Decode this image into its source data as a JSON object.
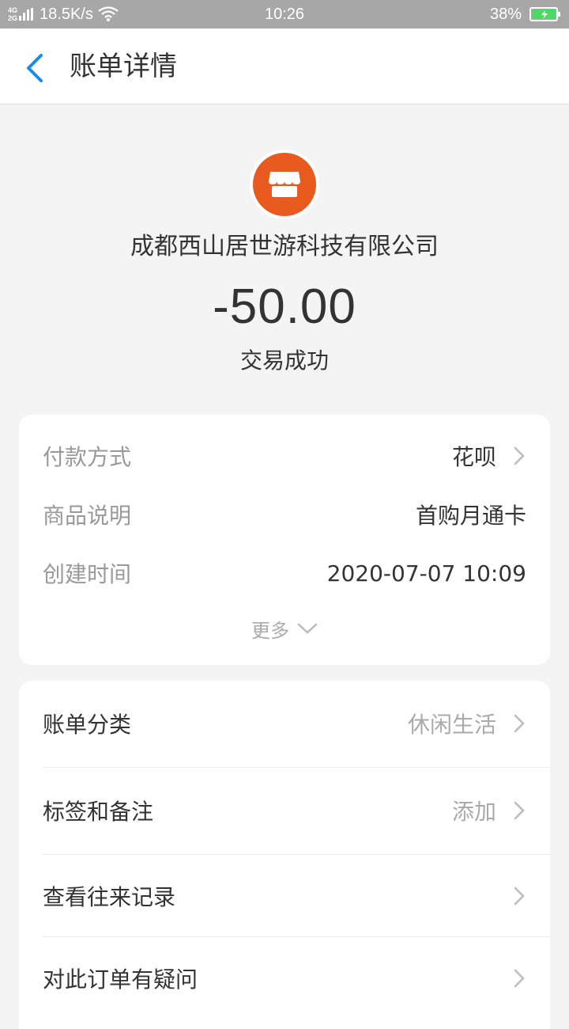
{
  "status_bar": {
    "network_top": "4G",
    "network_bottom": "2G",
    "speed": "18.5K/s",
    "time": "10:26",
    "battery": "38%"
  },
  "nav": {
    "title": "账单详情"
  },
  "header": {
    "merchant_name": "成都西山居世游科技有限公司",
    "amount": "-50.00",
    "status": "交易成功",
    "logo_color": "#e85a1e"
  },
  "details": {
    "rows": [
      {
        "label": "付款方式",
        "value": "花呗"
      },
      {
        "label": "商品说明",
        "value": "首购月通卡"
      },
      {
        "label": "创建时间",
        "value": "2020-07-07 10:09"
      }
    ],
    "more_label": "更多"
  },
  "actions": {
    "rows": [
      {
        "label": "账单分类",
        "value": "休闲生活"
      },
      {
        "label": "标签和备注",
        "value": "添加"
      },
      {
        "label": "查看往来记录",
        "value": ""
      },
      {
        "label": "对此订单有疑问",
        "value": ""
      }
    ]
  },
  "colors": {
    "accent": "#1a8ce8",
    "battery_fill": "#4cd964"
  }
}
